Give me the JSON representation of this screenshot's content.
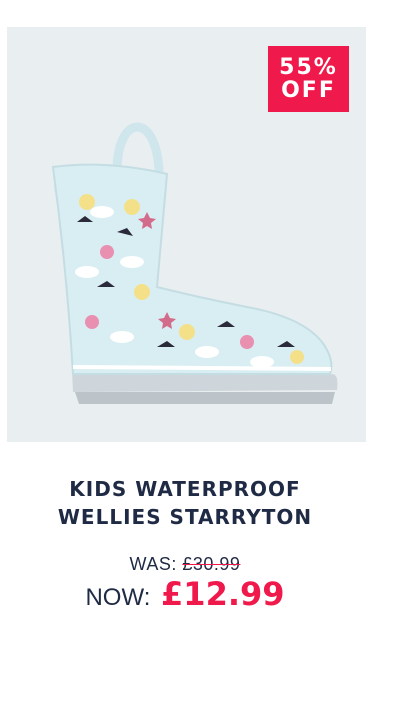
{
  "product": {
    "discount_line1": "55%",
    "discount_line2": "OFF",
    "title_line1": "KIDS WATERPROOF",
    "title_line2": "WELLIES STARRYTON",
    "was_label": "WAS:",
    "was_price": "£30.99",
    "now_label": "NOW:",
    "now_price": "£12.99"
  },
  "colors": {
    "accent": "#f0194b",
    "text": "#1f2a44",
    "image_bg": "#e9eef1"
  }
}
